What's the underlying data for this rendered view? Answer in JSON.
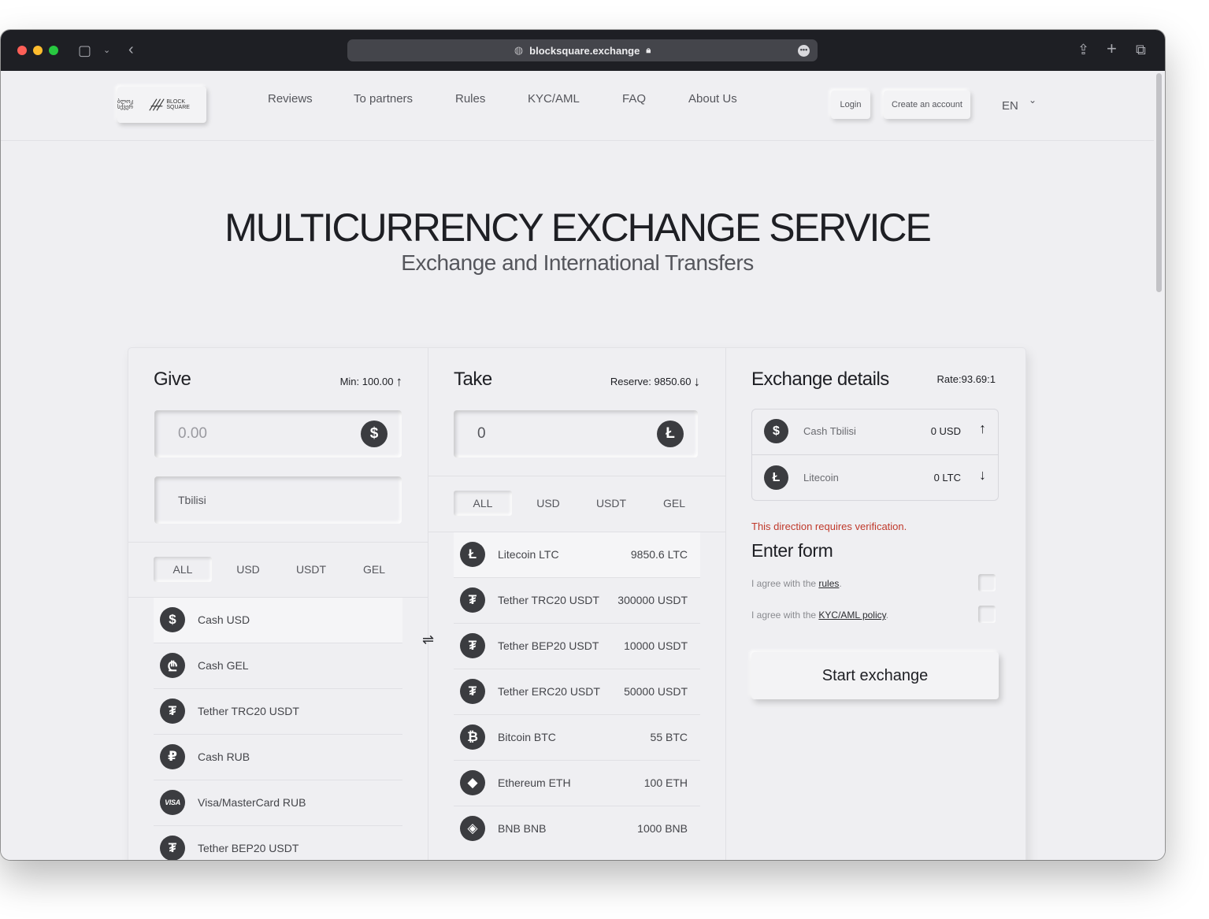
{
  "browser": {
    "url": "blocksquare.exchange"
  },
  "header": {
    "logo_text_left": "ბლოკ სქვერ",
    "logo_text_right": "BLOCK SQUARE",
    "nav": [
      "Reviews",
      "To partners",
      "Rules",
      "KYC/AML",
      "FAQ",
      "About Us"
    ],
    "login": "Login",
    "create_account": "Create an account",
    "language": "EN"
  },
  "hero": {
    "title": "MULTICURRENCY EXCHANGE SERVICE",
    "subtitle": "Exchange and International Transfers"
  },
  "give": {
    "title": "Give",
    "min_label": "Min: 100.00",
    "amount_placeholder": "0.00",
    "city": "Tbilisi",
    "tabs": [
      "ALL",
      "USD",
      "USDT",
      "GEL"
    ],
    "active_tab": "ALL",
    "items": [
      {
        "name": "Cash USD",
        "icon": "dollar-icon",
        "glyph": "$"
      },
      {
        "name": "Cash GEL",
        "icon": "lari-icon",
        "glyph": "₾"
      },
      {
        "name": "Tether TRC20 USDT",
        "icon": "tether-icon",
        "glyph": "₮"
      },
      {
        "name": "Cash RUB",
        "icon": "ruble-icon",
        "glyph": "₽"
      },
      {
        "name": "Visa/MasterCard RUB",
        "icon": "visa-icon",
        "glyph": "VISA"
      },
      {
        "name": "Tether BEP20 USDT",
        "icon": "tether-icon",
        "glyph": "₮"
      }
    ]
  },
  "take": {
    "title": "Take",
    "reserve_label": "Reserve: 9850.60",
    "amount_value": "0",
    "tabs": [
      "ALL",
      "USD",
      "USDT",
      "GEL"
    ],
    "active_tab": "ALL",
    "items": [
      {
        "name": "Litecoin LTC",
        "amount": "9850.6 LTC",
        "icon": "litecoin-icon",
        "glyph": "Ł"
      },
      {
        "name": "Tether TRC20 USDT",
        "amount": "300000 USDT",
        "icon": "tether-icon",
        "glyph": "₮"
      },
      {
        "name": "Tether BEP20 USDT",
        "amount": "10000 USDT",
        "icon": "tether-icon",
        "glyph": "₮"
      },
      {
        "name": "Tether ERC20 USDT",
        "amount": "50000 USDT",
        "icon": "tether-icon",
        "glyph": "₮"
      },
      {
        "name": "Bitcoin BTC",
        "amount": "55 BTC",
        "icon": "bitcoin-icon",
        "glyph": "₿"
      },
      {
        "name": "Ethereum ETH",
        "amount": "100 ETH",
        "icon": "ethereum-icon",
        "glyph": "◆"
      },
      {
        "name": "BNB BNB",
        "amount": "1000 BNB",
        "icon": "bnb-icon",
        "glyph": "◈"
      }
    ]
  },
  "details": {
    "title": "Exchange details",
    "rate": "Rate:93.69:1",
    "give_name": "Cash Tbilisi",
    "give_amount": "0 USD",
    "take_name": "Litecoin",
    "take_amount": "0 LTC",
    "warning": "This direction requires verification.",
    "form_title": "Enter form",
    "agree_rules_prefix": "I agree with the ",
    "agree_rules_link": "rules",
    "agree_kyc_prefix": "I agree with the ",
    "agree_kyc_link": "KYC/AML policy",
    "start_button": "Start exchange"
  },
  "colors": {
    "accent_dark": "#3b3c40",
    "warning": "#c0392b",
    "background": "#efeff2"
  }
}
